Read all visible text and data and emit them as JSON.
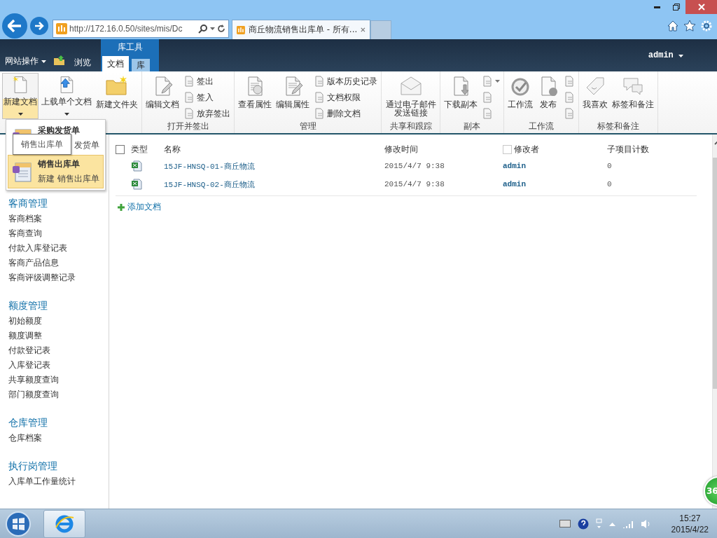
{
  "browser": {
    "address": "http://172.16.0.50/sites/mis/Dc",
    "tabs": [
      {
        "title": "商丘物流销售出库单 - 所有...",
        "selected": true
      }
    ]
  },
  "ribbon_header": {
    "site_actions": "网站操作",
    "tabs": [
      {
        "label": "浏览",
        "selected": false,
        "kind": "plain"
      },
      {
        "label": "文档",
        "selected": true,
        "kind": "context"
      },
      {
        "label": "库",
        "selected": false,
        "kind": "context"
      }
    ],
    "context_group": "库工具",
    "user": "admin"
  },
  "ribbon_groups": [
    {
      "large": [
        {
          "label": "新建文档",
          "dropdown": true,
          "selected": true
        },
        {
          "label": "上载单个文档",
          "dropdown": true,
          "selected": false
        },
        {
          "label": "新建文件夹",
          "dropdown": false,
          "selected": false
        }
      ]
    },
    {
      "label": "打开并签出",
      "large": [
        {
          "label": "编辑文档",
          "dropdown": false,
          "selected": false
        }
      ],
      "small": [
        {
          "kind": "text",
          "label": "签出"
        },
        {
          "kind": "text",
          "label": "签入"
        },
        {
          "kind": "text",
          "label": "放弃签出"
        }
      ]
    },
    {
      "label": "管理",
      "large": [
        {
          "label": "查看属性",
          "dropdown": false,
          "selected": false
        },
        {
          "label": "编辑属性",
          "dropdown": false,
          "selected": false
        }
      ],
      "small": [
        {
          "kind": "text",
          "label": "版本历史记录"
        },
        {
          "kind": "text",
          "label": "文档权限"
        },
        {
          "kind": "text",
          "label": "删除文档"
        }
      ]
    },
    {
      "label": "共享和跟踪",
      "large": [
        {
          "label": "通过电子邮件发送链接",
          "dropdown": false,
          "selected": false
        }
      ]
    },
    {
      "label": "副本",
      "large": [
        {
          "label": "下载副本",
          "dropdown": false,
          "selected": false
        }
      ],
      "small": [
        {
          "kind": "icon",
          "dropdown": true
        },
        {
          "kind": "icon",
          "dropdown": false
        },
        {
          "kind": "icon",
          "dropdown": false
        }
      ]
    },
    {
      "label": "工作流",
      "large": [
        {
          "label": "工作流",
          "dropdown": false,
          "selected": false
        },
        {
          "label": "发布",
          "dropdown": false,
          "selected": false
        }
      ],
      "small": [
        {
          "kind": "icon",
          "dropdown": false
        },
        {
          "kind": "icon",
          "dropdown": false
        },
        {
          "kind": "icon",
          "dropdown": false
        }
      ]
    },
    {
      "label": "标签和备注",
      "large": [
        {
          "label": "我喜欢",
          "dropdown": false,
          "selected": false
        },
        {
          "label": "标签和备注",
          "dropdown": false,
          "selected": false
        }
      ]
    }
  ],
  "new_menu": {
    "items": [
      {
        "title": "采购发货单",
        "description": "发货单",
        "selected": false
      },
      {
        "title": "销售出库单",
        "description": "新建 销售出库单",
        "selected": true
      }
    ],
    "tooltip": "销售出库单"
  },
  "nav": [
    {
      "heading": "客商管理",
      "items": [
        "客商档案",
        "客商查询",
        "付款入库登记表",
        "客商产品信息",
        "客商评级调整记录"
      ]
    },
    {
      "heading": "额度管理",
      "items": [
        "初始额度",
        "额度调整",
        "付款登记表",
        "入库登记表",
        "共享额度查询",
        "部门额度查询"
      ]
    },
    {
      "heading": "仓库管理",
      "items": [
        "仓库档案"
      ]
    },
    {
      "heading": "执行岗管理",
      "items": [
        "入库单工作量统计"
      ]
    }
  ],
  "table": {
    "select_all_checked": false,
    "columns": [
      {
        "label": "类型",
        "checkbox": false
      },
      {
        "label": "名称",
        "checkbox": false
      },
      {
        "label": "修改时间",
        "checkbox": false
      },
      {
        "label": "修改者",
        "checkbox": true,
        "checked": false
      },
      {
        "label": "子项目计数",
        "checkbox": false
      }
    ],
    "rows": [
      {
        "name": "15JF-HNSQ-01-商丘物流",
        "modified": "2015/4/7 9:38",
        "modified_by": "admin",
        "children": "0"
      },
      {
        "name": "15JF-HNSQ-02-商丘物流",
        "modified": "2015/4/7 9:38",
        "modified_by": "admin",
        "children": "0"
      }
    ],
    "add_link": "添加文档"
  },
  "floating_badge": "36",
  "taskbar": {
    "time": "15:27",
    "date": "2015/4/22"
  }
}
